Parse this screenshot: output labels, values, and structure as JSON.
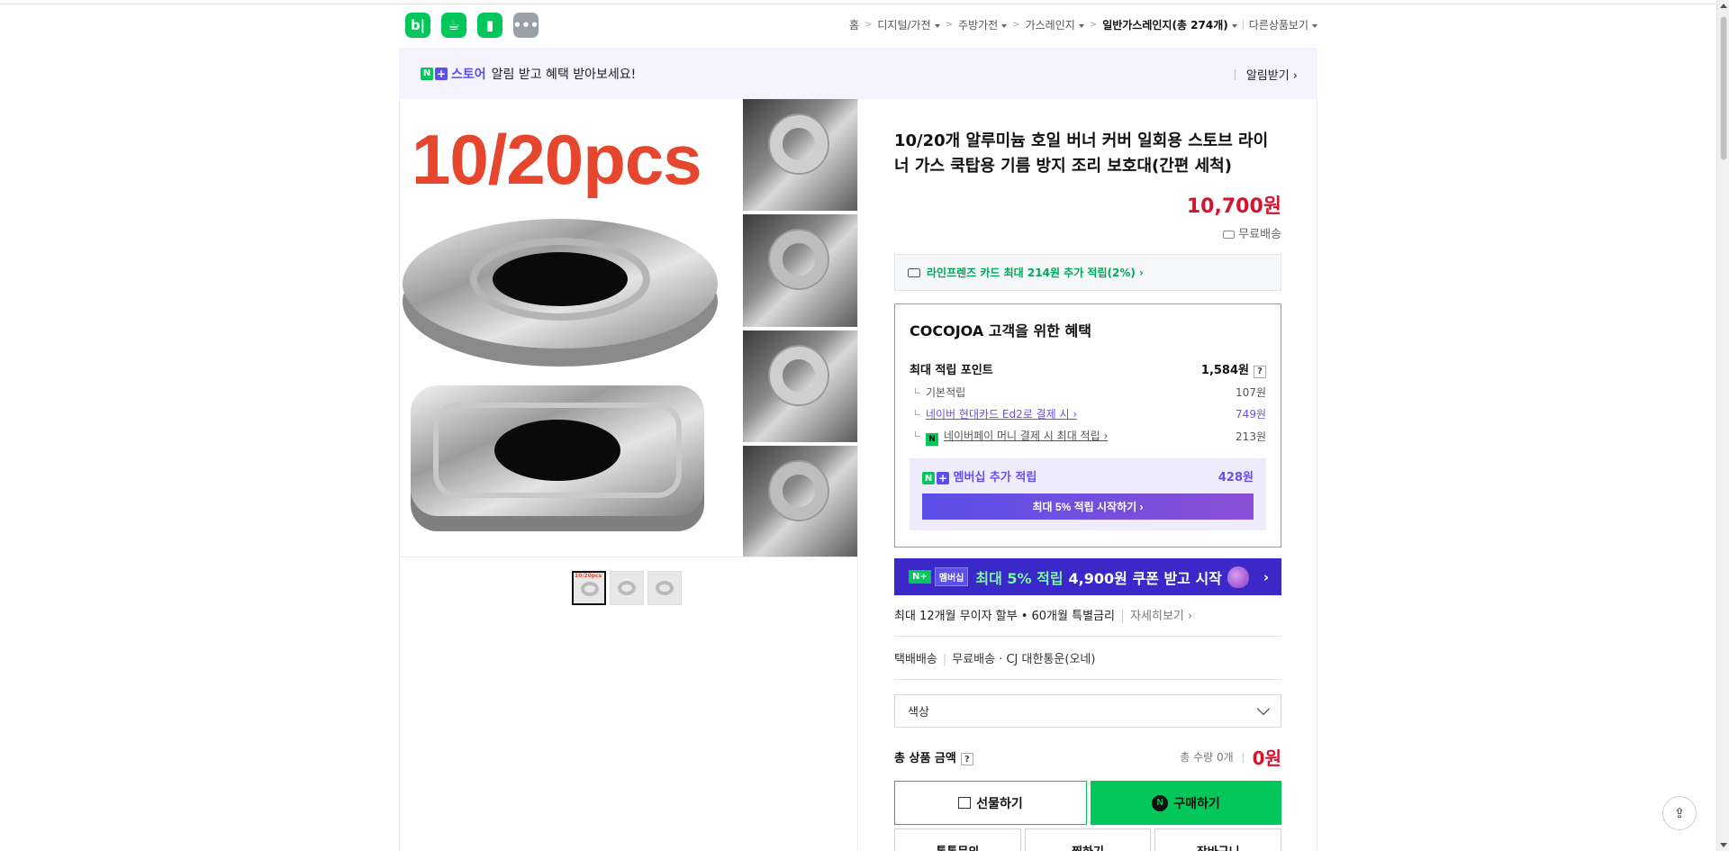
{
  "header": {
    "app_icons": [
      {
        "name": "blog-icon",
        "glyph": "b|"
      },
      {
        "name": "cafe-icon",
        "glyph": "☕"
      },
      {
        "name": "bookmark-icon",
        "glyph": "▮"
      },
      {
        "name": "more-icon",
        "glyph": "•••"
      }
    ],
    "breadcrumb": {
      "home": "홈",
      "c1": "디지털/가전",
      "c2": "주방가전",
      "c3": "가스레인지",
      "current": "일반가스레인지",
      "count": "(총 274개)",
      "other": "다른상품보기"
    }
  },
  "store_banner": {
    "n": "N",
    "plus": "+",
    "store": "스토어",
    "message": "알림 받고 혜택 받아보세요!",
    "alarm": "알림받기 ›"
  },
  "gallery": {
    "main_text": "10/20pcs",
    "thumb_label": "10/20pcs"
  },
  "product": {
    "title": "10/20개 알루미늄 호일 버너 커버 일회용 스토브 라이너 가스 쿡탑용 기름 방지 조리 보호대(간편 세척)",
    "price": "10,700원",
    "shipping": "무료배송",
    "card_benefit": "라인프렌즈 카드 최대 214원 추가 적립(2%) ›"
  },
  "benefit": {
    "title": "COCOJOA 고객을 위한 혜택",
    "max_points_label": "최대 적립 포인트",
    "max_points": "1,584원",
    "q": "?",
    "rows": [
      {
        "label": "기본적립",
        "value": "107원"
      },
      {
        "label": "네이버 현대카드 Ed2로 결제 시 ›",
        "value": "749원"
      },
      {
        "label": "네이버페이 머니 결제 시 최대 적립 ›",
        "value": "213원"
      }
    ],
    "npay": "N",
    "member_label": "멤버십 추가 적립",
    "member_value": "428원",
    "member_button": "최대 5% 적립 시작하기 ›"
  },
  "promo": {
    "tag1": "N+",
    "tag2": "멤버십",
    "highlight": "최대 5% 적립",
    "text": "4,900원 쿠폰 받고 시작",
    "chevron": "›"
  },
  "installment": {
    "text": "최대 12개월 무이자 할부 • 60개월 특별금리",
    "more": "자세히보기 ›"
  },
  "delivery": {
    "type": "택배배송",
    "fee": "무료배송",
    "carrier": "· CJ 대한통운(오네)"
  },
  "option": {
    "label": "색상"
  },
  "total": {
    "label": "총 상품 금액",
    "q": "?",
    "qty": "총 수량 0개",
    "amount": "0원"
  },
  "buttons": {
    "gift": "선물하기",
    "buy": "구매하기",
    "buy_n": "N",
    "talk": "톡톡문의",
    "wish": "찜하기",
    "cart": "장바구니"
  },
  "colors": {
    "naver_green": "#03c75a",
    "price_red": "#d4142b",
    "membership_purple": "#6a4ff0"
  }
}
